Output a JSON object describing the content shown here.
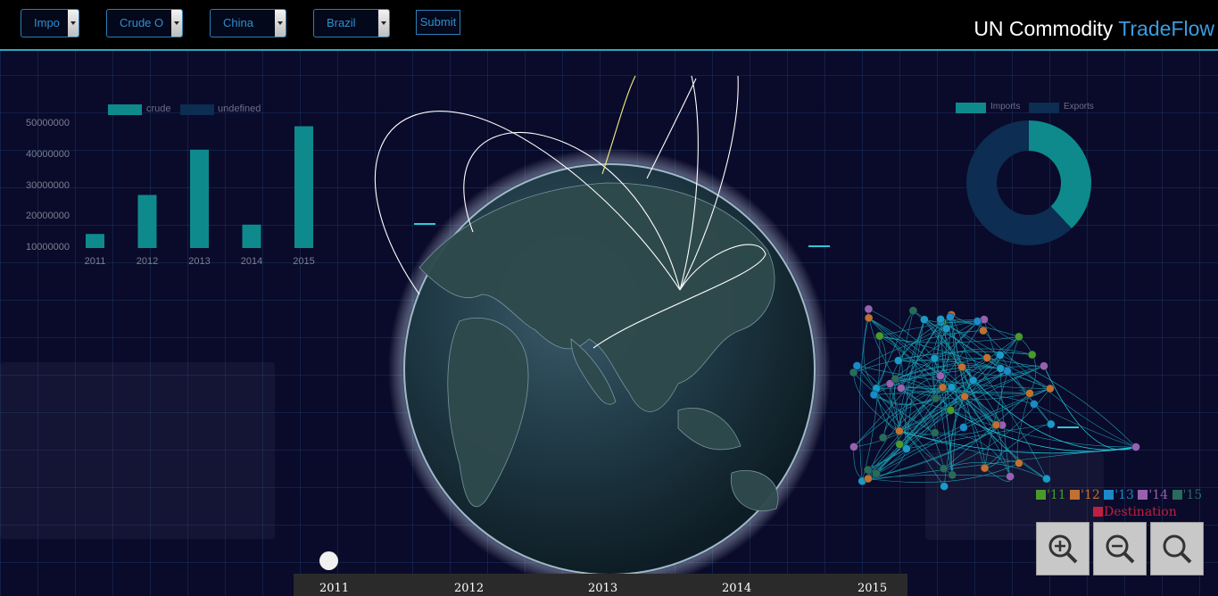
{
  "toolbar": {
    "selects": [
      {
        "value": "Impo"
      },
      {
        "value": "Crude O"
      },
      {
        "value": "China"
      },
      {
        "value": "Brazil"
      }
    ],
    "submit_label": "Submit"
  },
  "title": {
    "part1": "UN Commodity ",
    "part2": "TradeFlow"
  },
  "bar_chart": {
    "legend": [
      "crude",
      "undefined"
    ],
    "y_ticks": [
      "50000000",
      "40000000",
      "30000000",
      "20000000",
      "10000000"
    ]
  },
  "chart_data": [
    {
      "type": "bar",
      "categories": [
        "2011",
        "2012",
        "2013",
        "2014",
        "2015"
      ],
      "series": [
        {
          "name": "crude",
          "values": [
            14500000,
            27000000,
            41500000,
            17500000,
            49000000
          ]
        }
      ],
      "ylim": [
        10000000,
        50000000
      ],
      "legend": [
        "crude",
        "undefined"
      ],
      "color": "#0e8a8c"
    },
    {
      "type": "pie",
      "donut": true,
      "labels": [
        "Imports",
        "Exports"
      ],
      "values": [
        38,
        62
      ],
      "colors": [
        "#0e8a8c",
        "#0d2d52"
      ]
    }
  ],
  "donut": {
    "legend": [
      "Imports",
      "Exports"
    ]
  },
  "timeline": {
    "years": [
      "2011",
      "2012",
      "2013",
      "2014",
      "2015"
    ],
    "selected": "2011"
  },
  "network_key": [
    {
      "label": "'11",
      "color": "#4a9a2a"
    },
    {
      "label": "'12",
      "color": "#c07030"
    },
    {
      "label": "'13",
      "color": "#1a8ac8"
    },
    {
      "label": "'14",
      "color": "#9a60b0"
    },
    {
      "label": "'15",
      "color": "#2a6a5a"
    }
  ],
  "destination_label": "Destination",
  "destination_color": "#c02040",
  "zoom": {
    "icons": [
      "zoom-in-icon",
      "zoom-out-icon",
      "zoom-reset-icon"
    ]
  }
}
